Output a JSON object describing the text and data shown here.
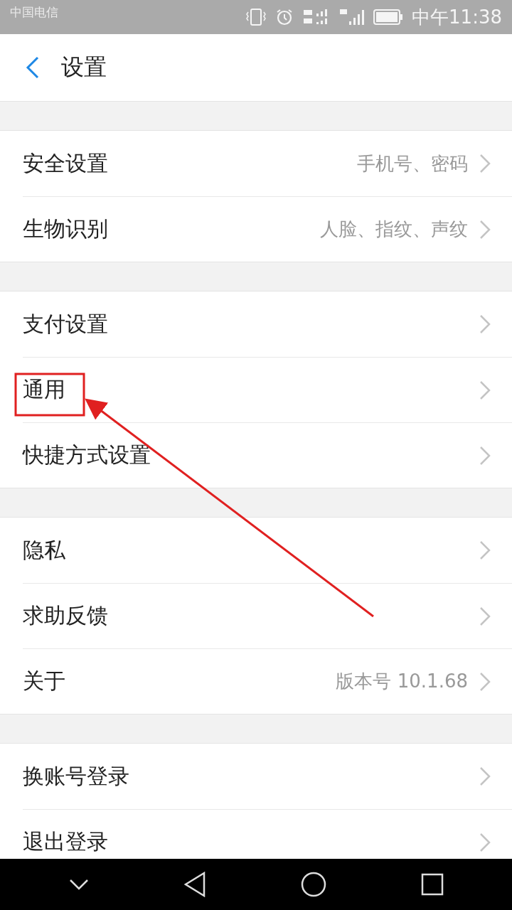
{
  "status_bar": {
    "carrier": "中国电信",
    "time": "中午11:38"
  },
  "header": {
    "title": "设置"
  },
  "sections": [
    {
      "rows": [
        {
          "label": "安全设置",
          "value": "手机号、密码"
        },
        {
          "label": "生物识别",
          "value": "人脸、指纹、声纹"
        }
      ]
    },
    {
      "rows": [
        {
          "label": "支付设置"
        },
        {
          "label": "通用",
          "highlighted": true
        },
        {
          "label": "快捷方式设置"
        }
      ]
    },
    {
      "rows": [
        {
          "label": "隐私"
        },
        {
          "label": "求助反馈"
        },
        {
          "label": "关于",
          "value": "版本号 10.1.68"
        }
      ]
    },
    {
      "rows": [
        {
          "label": "换账号登录"
        },
        {
          "label": "退出登录"
        }
      ]
    }
  ]
}
